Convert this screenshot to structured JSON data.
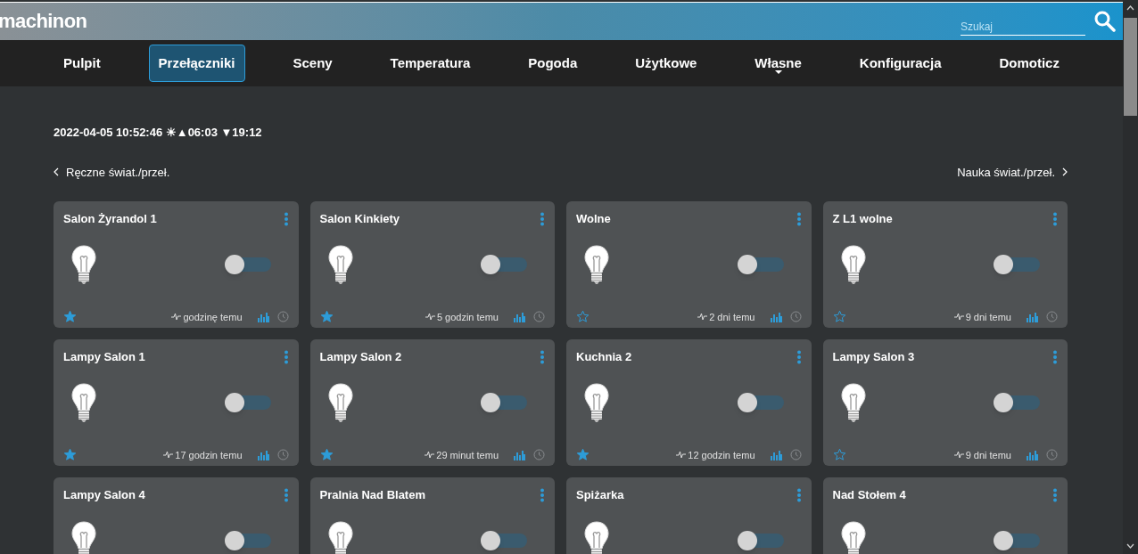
{
  "header": {
    "logo": "machinon",
    "search": {
      "placeholder": "Szukaj"
    }
  },
  "nav": [
    {
      "label": "Pulpit",
      "selected": false,
      "dropdown": false
    },
    {
      "label": "Przełączniki",
      "selected": true,
      "dropdown": false
    },
    {
      "label": "Sceny",
      "selected": false,
      "dropdown": false
    },
    {
      "label": "Temperatura",
      "selected": false,
      "dropdown": false
    },
    {
      "label": "Pogoda",
      "selected": false,
      "dropdown": false
    },
    {
      "label": "Użytkowe",
      "selected": false,
      "dropdown": false
    },
    {
      "label": "Własne",
      "selected": false,
      "dropdown": true
    },
    {
      "label": "Konfiguracja",
      "selected": false,
      "dropdown": false
    },
    {
      "label": "Domoticz",
      "selected": false,
      "dropdown": false
    }
  ],
  "sun_info": "2022-04-05 10:52:46 ☀▲06:03 ▼19:12",
  "pager": {
    "previous": "Ręczne świat./przeł.",
    "next": "Nauka świat./przeł."
  },
  "devices": [
    {
      "name": "Salon Żyrandol 1",
      "on": false,
      "favorite": true,
      "last_seen": "godzinę temu"
    },
    {
      "name": "Salon Kinkiety",
      "on": false,
      "favorite": true,
      "last_seen": "5 godzin temu"
    },
    {
      "name": "Wolne",
      "on": false,
      "favorite": false,
      "last_seen": "2 dni temu"
    },
    {
      "name": "Z L1 wolne",
      "on": false,
      "favorite": false,
      "last_seen": "9 dni temu"
    },
    {
      "name": "Lampy Salon 1",
      "on": false,
      "favorite": true,
      "last_seen": "17 godzin temu"
    },
    {
      "name": "Lampy Salon 2",
      "on": false,
      "favorite": true,
      "last_seen": "29 minut temu"
    },
    {
      "name": "Kuchnia 2",
      "on": false,
      "favorite": true,
      "last_seen": "12 godzin temu"
    },
    {
      "name": "Lampy Salon 3",
      "on": false,
      "favorite": false,
      "last_seen": "9 dni temu"
    },
    {
      "name": "Lampy Salon 4",
      "on": false
    },
    {
      "name": "Pralnia Nad Blatem",
      "on": false
    },
    {
      "name": "Spiżarka",
      "on": false
    },
    {
      "name": "Nad Stołem 4",
      "on": false
    }
  ]
}
